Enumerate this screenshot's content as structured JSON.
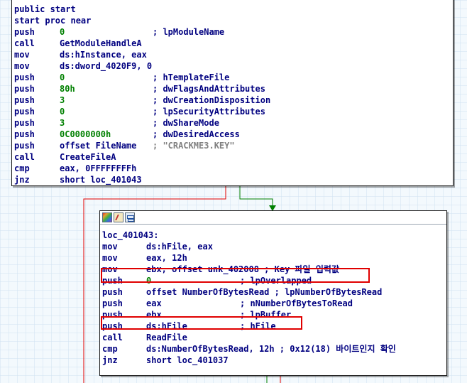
{
  "block1": {
    "header": [
      "public start",
      "start proc near"
    ],
    "lines": [
      {
        "mn": "push",
        "op": "0",
        "op_color": "green",
        "cm": "; lpModuleName",
        "cm_color": "navy"
      },
      {
        "mn": "call",
        "op": "GetModuleHandleA",
        "op_color": "navy",
        "cm": "",
        "cm_color": "navy"
      },
      {
        "mn": "mov",
        "op": "ds:hInstance, eax",
        "op_color": "navy",
        "cm": "",
        "cm_color": "navy"
      },
      {
        "mn": "mov",
        "op": "ds:dword_4020F9, 0",
        "op_color": "navy",
        "cm": "",
        "cm_color": "navy"
      },
      {
        "mn": "push",
        "op": "0",
        "op_color": "green",
        "cm": "; hTemplateFile",
        "cm_color": "navy"
      },
      {
        "mn": "push",
        "op": "80h",
        "op_color": "green",
        "cm": "; dwFlagsAndAttributes",
        "cm_color": "navy"
      },
      {
        "mn": "push",
        "op": "3",
        "op_color": "green",
        "cm": "; dwCreationDisposition",
        "cm_color": "navy"
      },
      {
        "mn": "push",
        "op": "0",
        "op_color": "green",
        "cm": "; lpSecurityAttributes",
        "cm_color": "navy"
      },
      {
        "mn": "push",
        "op": "3",
        "op_color": "green",
        "cm": "; dwShareMode",
        "cm_color": "navy"
      },
      {
        "mn": "push",
        "op": "0C0000000h",
        "op_color": "green",
        "cm": "; dwDesiredAccess",
        "cm_color": "navy"
      },
      {
        "mn": "push",
        "op": "offset FileName",
        "op_color": "navy",
        "cm": "; \"CRACKME3.KEY\"",
        "cm_color": "gray"
      },
      {
        "mn": "call",
        "op": "CreateFileA",
        "op_color": "navy",
        "cm": "",
        "cm_color": "navy"
      },
      {
        "mn": "cmp",
        "op": "eax, 0FFFFFFFFh",
        "op_color": "navy",
        "cm": "",
        "cm_color": "navy"
      },
      {
        "mn": "jnz",
        "op": "short loc_401043",
        "op_color": "navy",
        "cm": "",
        "cm_color": "navy"
      }
    ]
  },
  "block2": {
    "label": "loc_401043:",
    "lines": [
      {
        "mn": "mov",
        "op": "ds:hFile, eax",
        "op_color": "navy",
        "cm": "",
        "cm_color": "navy"
      },
      {
        "mn": "mov",
        "op": "eax, 12h",
        "op_color": "navy",
        "cm": "",
        "cm_color": "navy"
      },
      {
        "mn": "mov",
        "op": "ebx, offset unk_402008 ; Key 파일 입력값",
        "op_color": "navy",
        "cm": "",
        "cm_color": "navy"
      },
      {
        "mn": "push",
        "op": "0",
        "op_color": "green",
        "cm": "; lpOverlapped",
        "cm_color": "navy"
      },
      {
        "mn": "push",
        "op": "offset NumberOfBytesRead ; lpNumberOfBytesRead",
        "op_color": "navy",
        "cm": "",
        "cm_color": "navy"
      },
      {
        "mn": "push",
        "op": "eax",
        "op_color": "navy",
        "cm": "; nNumberOfBytesToRead",
        "cm_color": "navy"
      },
      {
        "mn": "push",
        "op": "ebx",
        "op_color": "navy",
        "cm": "; lpBuffer",
        "cm_color": "navy"
      },
      {
        "mn": "push",
        "op": "ds:hFile",
        "op_color": "navy",
        "cm": "; hFile",
        "cm_color": "navy"
      },
      {
        "mn": "call",
        "op": "ReadFile",
        "op_color": "navy",
        "cm": "",
        "cm_color": "navy"
      },
      {
        "mn": "cmp",
        "op": "ds:NumberOfBytesRead, 12h ; 0x12(18) 바이트인지 확인",
        "op_color": "navy",
        "cm": "",
        "cm_color": "navy"
      },
      {
        "mn": "jnz",
        "op": "short loc_401037",
        "op_color": "navy",
        "cm": "",
        "cm_color": "navy"
      }
    ]
  },
  "colors": {
    "navy": "#000080",
    "green": "#008000",
    "gray": "#808080",
    "highlight": "#e00000",
    "edge_false": "#e00000",
    "edge_true": "#008000",
    "edge_plain": "#3060c0"
  },
  "icons": [
    "color-palette-icon",
    "edit-pencil-icon",
    "graph-overview-icon"
  ]
}
